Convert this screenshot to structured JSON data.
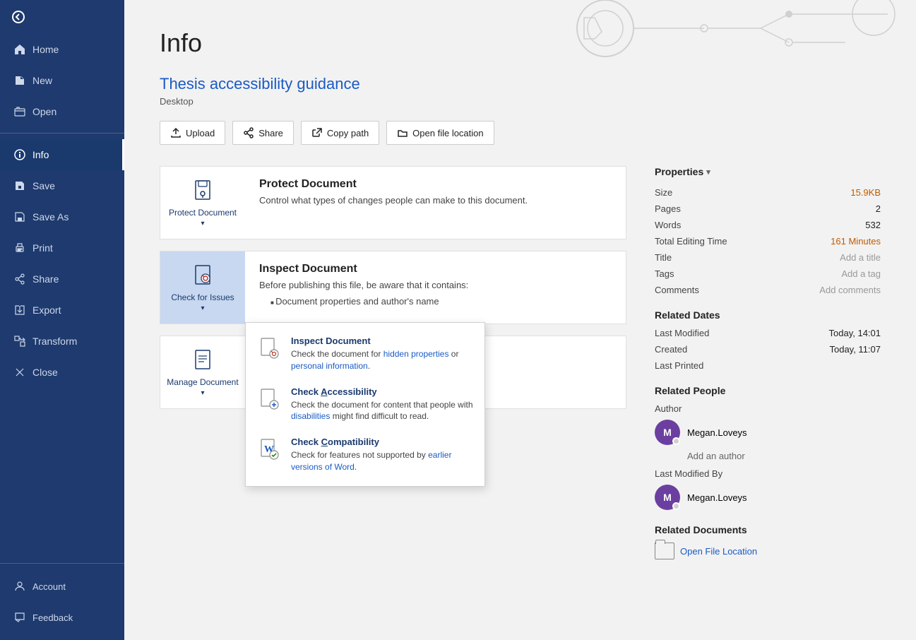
{
  "sidebar": {
    "back_label": "",
    "items": [
      {
        "id": "home",
        "label": "Home",
        "icon": "home"
      },
      {
        "id": "new",
        "label": "New",
        "icon": "new"
      },
      {
        "id": "open",
        "label": "Open",
        "icon": "open"
      },
      {
        "id": "info",
        "label": "Info",
        "icon": "info",
        "active": true
      },
      {
        "id": "save",
        "label": "Save",
        "icon": "save"
      },
      {
        "id": "save-as",
        "label": "Save As",
        "icon": "save-as"
      },
      {
        "id": "print",
        "label": "Print",
        "icon": "print"
      },
      {
        "id": "share",
        "label": "Share",
        "icon": "share"
      },
      {
        "id": "export",
        "label": "Export",
        "icon": "export"
      },
      {
        "id": "transform",
        "label": "Transform",
        "icon": "transform"
      },
      {
        "id": "close",
        "label": "Close",
        "icon": "close"
      }
    ],
    "bottom_items": [
      {
        "id": "account",
        "label": "Account",
        "icon": "account"
      },
      {
        "id": "feedback",
        "label": "Feedback",
        "icon": "feedback"
      }
    ]
  },
  "page": {
    "title": "Info",
    "doc_title": "Thesis accessibility guidance",
    "doc_location": "Desktop",
    "action_buttons": [
      {
        "id": "upload",
        "label": "Upload",
        "icon": "upload"
      },
      {
        "id": "share",
        "label": "Share",
        "icon": "share"
      },
      {
        "id": "copy-path",
        "label": "Copy path",
        "icon": "copy"
      },
      {
        "id": "open-file-location",
        "label": "Open file location",
        "icon": "folder"
      }
    ]
  },
  "protect_document": {
    "icon_label": "Protect Document",
    "chevron": "▾",
    "heading": "Protect Document",
    "description": "Control what types of changes people can make to this document."
  },
  "inspect_document": {
    "icon_label": "Check for Issues",
    "chevron": "▾",
    "heading": "Inspect Document",
    "description": "Before publishing this file, be aware that it contains:",
    "bullet": "Document properties and author's name",
    "highlighted": true,
    "dropdown": {
      "items": [
        {
          "id": "inspect",
          "title": "Inspect Document",
          "desc_parts": [
            "Check the document for ",
            "hidden properties",
            " or ",
            "personal information",
            "."
          ]
        },
        {
          "id": "accessibility",
          "title": "Check Accessibility",
          "underline": "A",
          "desc_parts": [
            "Check the document for content that people with ",
            "disabilities",
            " might find difficult to read."
          ]
        },
        {
          "id": "compatibility",
          "title": "Check Compatibility",
          "underline": "C",
          "desc_parts": [
            "Check for features not supported by ",
            "earlier versions of Word",
            "."
          ]
        }
      ]
    }
  },
  "manage_document": {
    "icon_label": "Manage Document",
    "chevron": "▾"
  },
  "properties": {
    "header": "Properties",
    "size_label": "Size",
    "size_value": "15.9KB",
    "pages_label": "Pages",
    "pages_value": "2",
    "words_label": "Words",
    "words_value": "532",
    "editing_time_label": "Total Editing Time",
    "editing_time_value": "161 Minutes",
    "title_label": "Title",
    "title_value": "Add a title",
    "tags_label": "Tags",
    "tags_value": "Add a tag",
    "comments_label": "Comments",
    "comments_value": "Add comments"
  },
  "related_dates": {
    "header": "Related Dates",
    "last_modified_label": "Last Modified",
    "last_modified_value": "Today, 14:01",
    "created_label": "Created",
    "created_value": "Today, 11:07",
    "last_printed_label": "Last Printed",
    "last_printed_value": ""
  },
  "related_people": {
    "header": "Related People",
    "author_label": "Author",
    "author_name": "Megan.Loveys",
    "author_initial": "M",
    "add_author": "Add an author",
    "last_modified_by_label": "Last Modified By",
    "last_modified_by_name": "Megan.Loveys",
    "last_modified_by_initial": "M"
  },
  "related_documents": {
    "header": "Related Documents",
    "open_file_location": "Open File Location"
  }
}
